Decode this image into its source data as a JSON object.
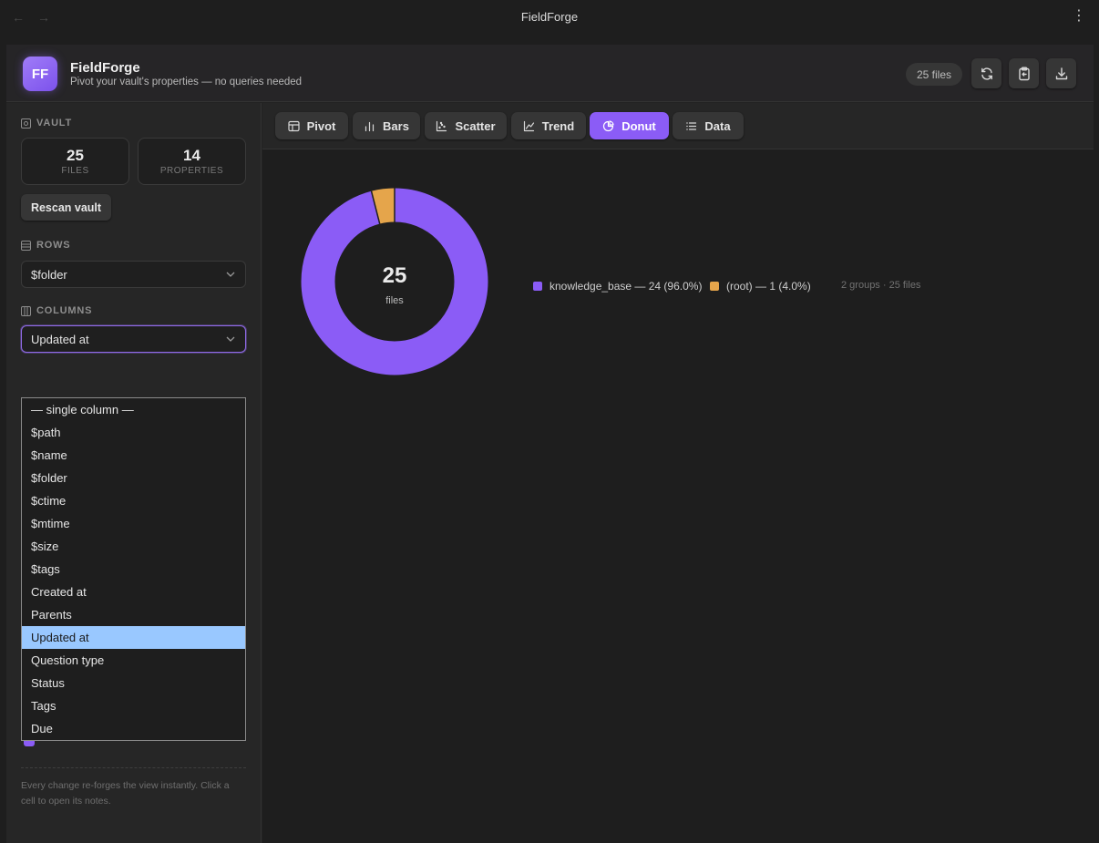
{
  "window": {
    "title": "FieldForge"
  },
  "header": {
    "logo_text": "FF",
    "app_name": "FieldForge",
    "tagline": "Pivot your vault's properties — no queries needed",
    "files_badge": "25 files"
  },
  "sidebar": {
    "vault_label": "VAULT",
    "files_count": "25",
    "files_label": "FILES",
    "properties_count": "14",
    "properties_label": "PROPERTIES",
    "rescan_label": "Rescan vault",
    "rows_label": "ROWS",
    "rows_value": "$folder",
    "columns_label": "COLUMNS",
    "columns_value": "Updated at",
    "column_options": [
      "— single column —",
      "$path",
      "$name",
      "$folder",
      "$ctime",
      "$mtime",
      "$size",
      "$tags",
      "Created at",
      "Parents",
      "Updated at",
      "Question type",
      "Status",
      "Tags",
      "Due"
    ],
    "selected_option": "Updated at",
    "hint": "Every change re-forges the view instantly. Click a cell to open its notes."
  },
  "tabs": [
    {
      "label": "Pivot",
      "icon": "table-icon"
    },
    {
      "label": "Bars",
      "icon": "bar-chart-icon"
    },
    {
      "label": "Scatter",
      "icon": "scatter-icon"
    },
    {
      "label": "Trend",
      "icon": "line-chart-icon"
    },
    {
      "label": "Donut",
      "icon": "pie-chart-icon",
      "active": true
    },
    {
      "label": "Data",
      "icon": "list-icon"
    }
  ],
  "colors": {
    "accent": "#8b5cf6",
    "series_2": "#e5a54b"
  },
  "chart_data": {
    "type": "pie",
    "center_value": "25",
    "center_label": "files",
    "slices": [
      {
        "name": "knowledge_base",
        "value": 24,
        "color": "#8b5cf6",
        "legend": "knowledge_base — 24 (96.0%)"
      },
      {
        "name": "(root)",
        "value": 1,
        "color": "#e5a54b",
        "legend": "(root) — 1 (4.0%)"
      }
    ],
    "summary": "2 groups · 25 files"
  }
}
